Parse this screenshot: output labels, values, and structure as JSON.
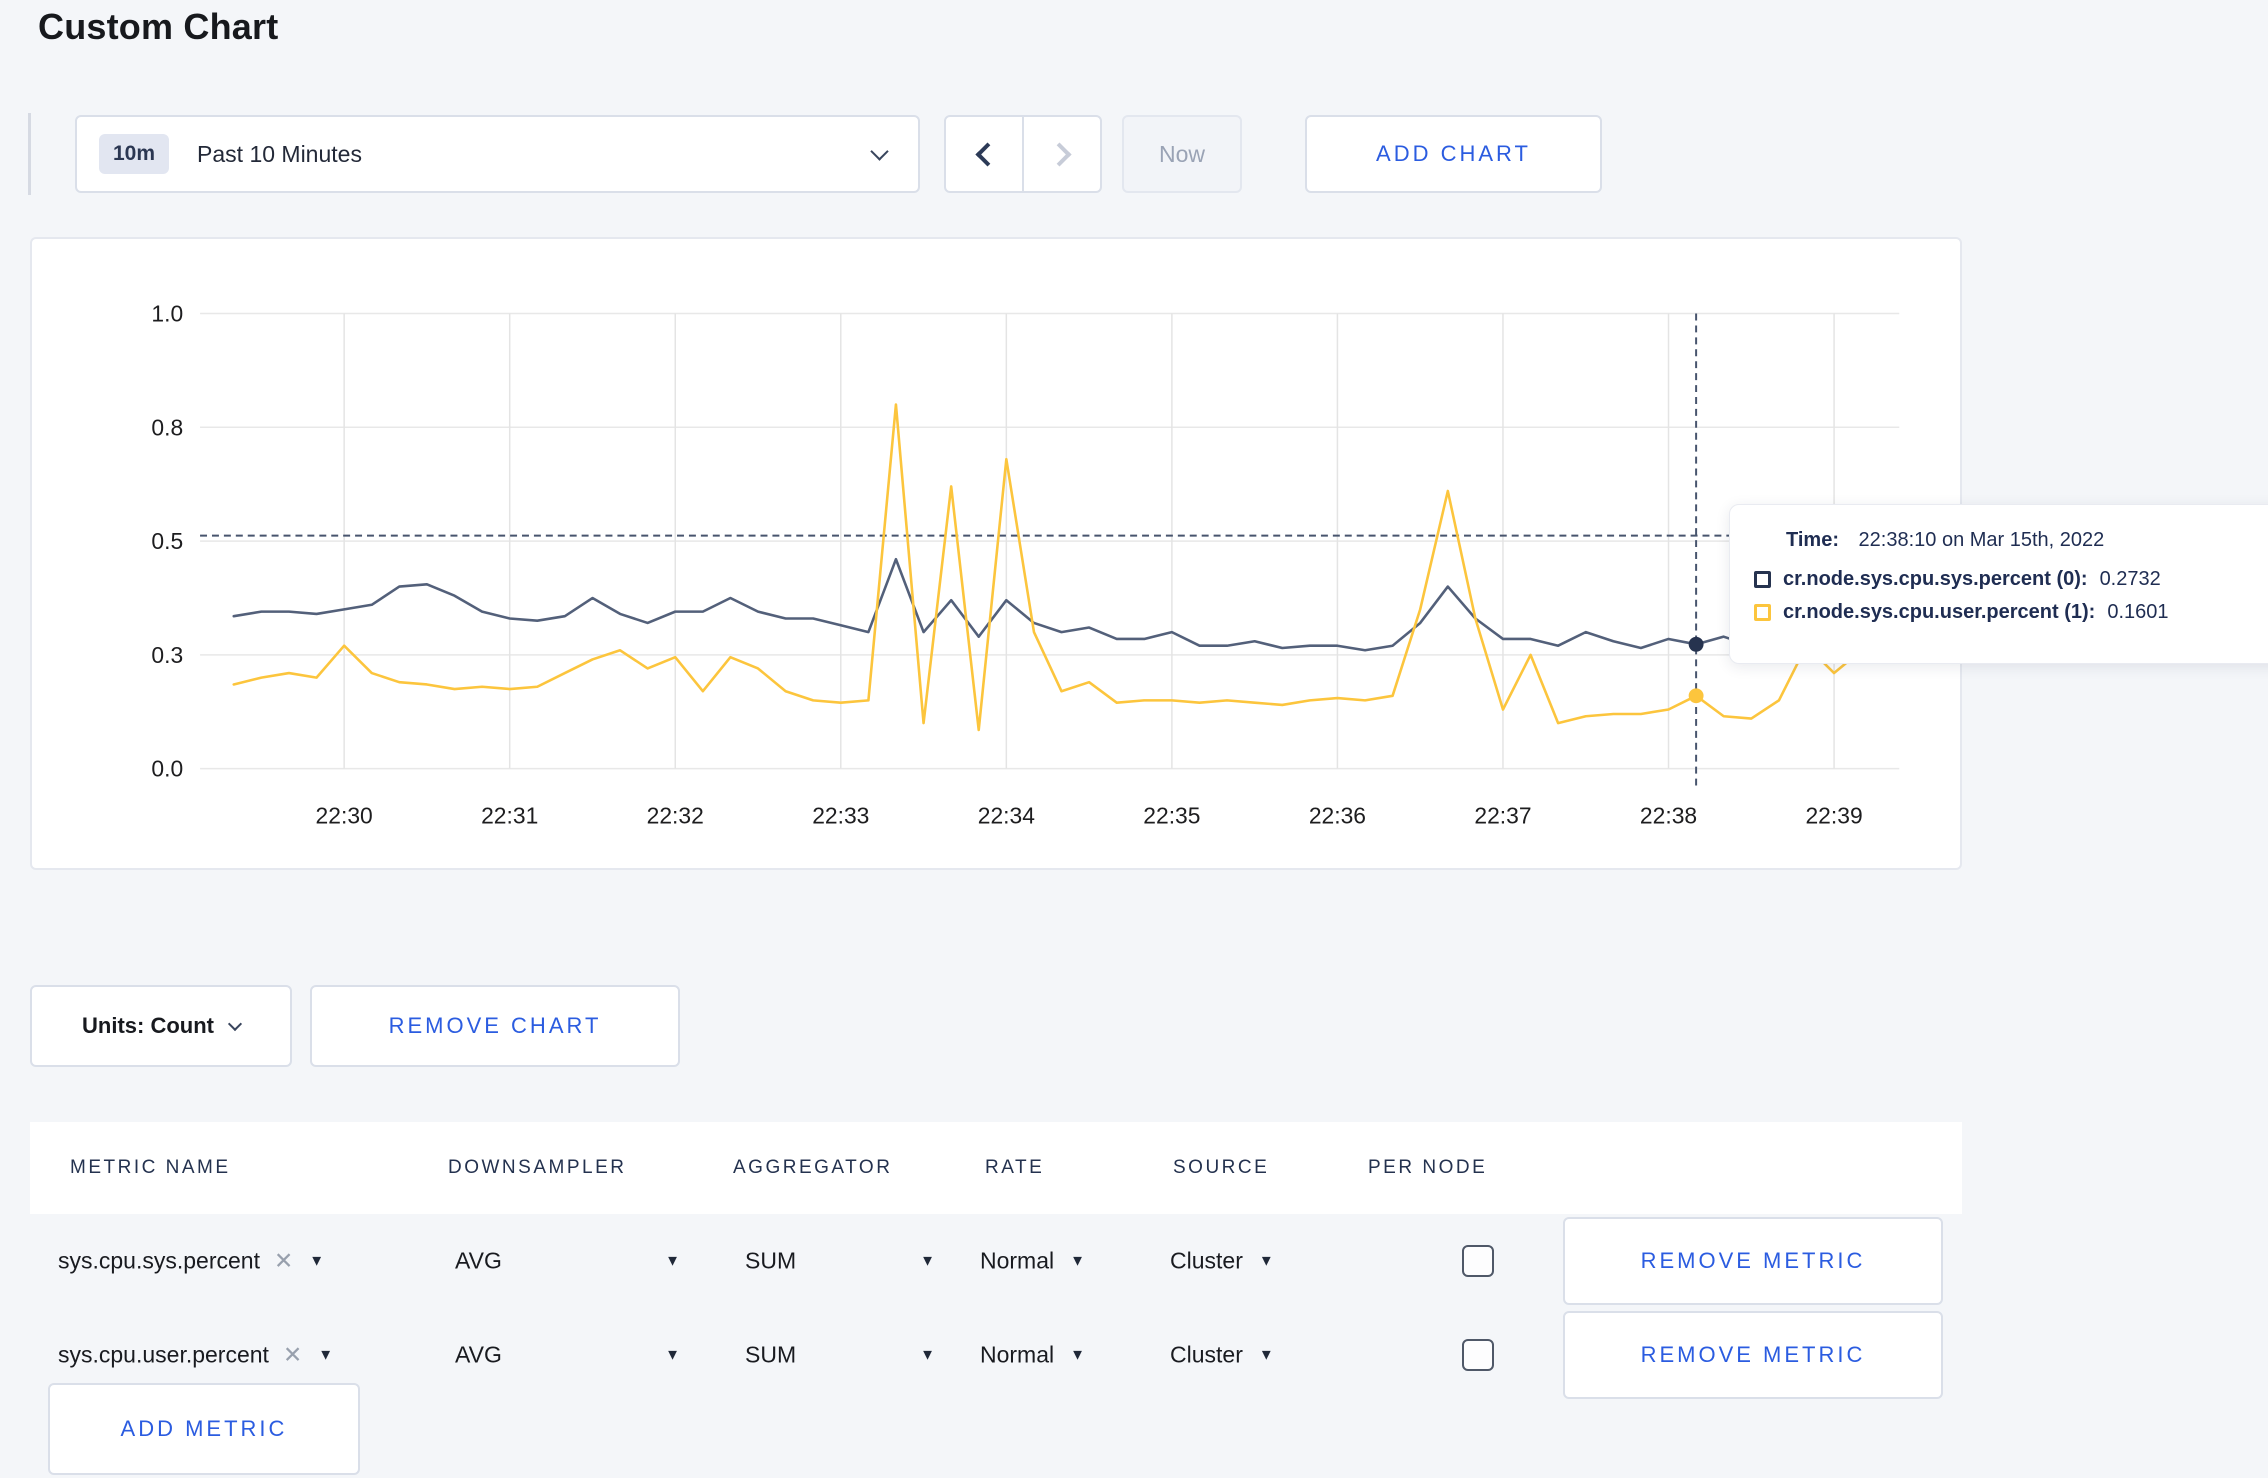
{
  "page": {
    "title": "Custom Chart",
    "background_color": "#f4f6f9",
    "accent_blue": "#2b5ce0"
  },
  "toolbar": {
    "range_badge": "10m",
    "range_label": "Past 10 Minutes",
    "now_label": "Now",
    "add_chart_label": "ADD CHART"
  },
  "chart": {
    "tooltip": {
      "time_label": "Time:",
      "time_value": "22:38:10 on Mar 15th, 2022",
      "rows": [
        {
          "label": "cr.node.sys.cpu.sys.percent (0):",
          "value": "0.2732",
          "color": "#26334f"
        },
        {
          "label": "cr.node.sys.cpu.user.percent (1):",
          "value": "0.1601",
          "color": "#fcc53d"
        }
      ]
    }
  },
  "chart_data": {
    "type": "line",
    "title": "",
    "xlabel": "",
    "ylabel": "",
    "ylim": [
      0,
      1
    ],
    "grid": true,
    "legend_position": "tooltip",
    "x_start_time": "22:29:20",
    "x_step_seconds": 10,
    "x_ticks": [
      "22:30",
      "22:31",
      "22:32",
      "22:33",
      "22:34",
      "22:35",
      "22:36",
      "22:37",
      "22:38",
      "22:39"
    ],
    "y_tick_values": [
      0,
      0.25,
      0.5,
      0.75,
      1.0
    ],
    "y_tick_labels": [
      "0.0",
      "0.3",
      "0.5",
      "0.8",
      "1.0"
    ],
    "series": [
      {
        "name": "cr.node.sys.cpu.sys.percent",
        "color": "#53607a",
        "values": [
          0.335,
          0.345,
          0.345,
          0.34,
          0.35,
          0.36,
          0.4,
          0.405,
          0.38,
          0.345,
          0.33,
          0.325,
          0.335,
          0.375,
          0.34,
          0.32,
          0.345,
          0.345,
          0.375,
          0.345,
          0.33,
          0.33,
          0.315,
          0.3,
          0.46,
          0.3,
          0.37,
          0.29,
          0.37,
          0.32,
          0.3,
          0.31,
          0.285,
          0.285,
          0.3,
          0.27,
          0.27,
          0.28,
          0.265,
          0.27,
          0.27,
          0.26,
          0.27,
          0.32,
          0.4,
          0.33,
          0.285,
          0.285,
          0.27,
          0.3,
          0.28,
          0.265,
          0.285,
          0.2732,
          0.29,
          0.27,
          0.27,
          0.28,
          0.275,
          0.27
        ]
      },
      {
        "name": "cr.node.sys.cpu.user.percent",
        "color": "#fcc53d",
        "values": [
          0.185,
          0.2,
          0.21,
          0.2,
          0.27,
          0.21,
          0.19,
          0.185,
          0.175,
          0.18,
          0.175,
          0.18,
          0.21,
          0.24,
          0.26,
          0.22,
          0.245,
          0.17,
          0.245,
          0.22,
          0.17,
          0.15,
          0.145,
          0.15,
          0.8,
          0.1,
          0.62,
          0.085,
          0.68,
          0.3,
          0.17,
          0.19,
          0.145,
          0.15,
          0.15,
          0.145,
          0.15,
          0.145,
          0.14,
          0.15,
          0.155,
          0.15,
          0.16,
          0.35,
          0.61,
          0.33,
          0.13,
          0.25,
          0.1,
          0.115,
          0.12,
          0.12,
          0.13,
          0.1601,
          0.115,
          0.11,
          0.15,
          0.27,
          0.21,
          0.26
        ]
      }
    ],
    "crosshair": {
      "time": "22:38:10",
      "x_seconds_from_start": 530,
      "hline_value": 0.512,
      "hover_values": [
        0.2732,
        0.1601
      ]
    }
  },
  "units": {
    "label": "Units: Count",
    "remove_chart_label": "REMOVE CHART"
  },
  "table": {
    "headers": [
      "METRIC NAME",
      "DOWNSAMPLER",
      "AGGREGATOR",
      "RATE",
      "SOURCE",
      "PER NODE"
    ],
    "rows": [
      {
        "name": "sys.cpu.sys.percent",
        "downsampler": "AVG",
        "aggregator": "SUM",
        "rate": "Normal",
        "source": "Cluster",
        "per_node_checked": false
      },
      {
        "name": "sys.cpu.user.percent",
        "downsampler": "AVG",
        "aggregator": "SUM",
        "rate": "Normal",
        "source": "Cluster",
        "per_node_checked": false
      }
    ],
    "remove_metric_label": "REMOVE METRIC",
    "add_metric_label": "ADD METRIC"
  }
}
